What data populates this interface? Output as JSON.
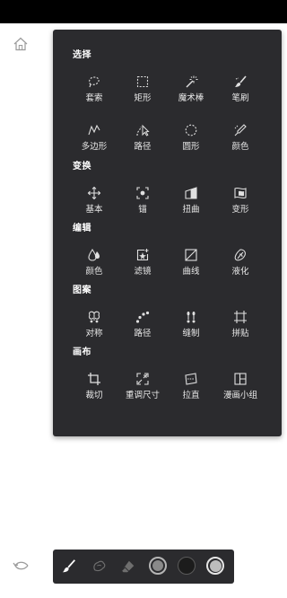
{
  "sections": [
    {
      "title": "选择",
      "tools": [
        {
          "label": "套索",
          "icon": "lasso-icon"
        },
        {
          "label": "矩形",
          "icon": "rectangle-select-icon"
        },
        {
          "label": "魔术棒",
          "icon": "magic-wand-icon"
        },
        {
          "label": "笔刷",
          "icon": "brush-select-icon"
        }
      ]
    },
    {
      "title": "",
      "tools": [
        {
          "label": "多边形",
          "icon": "polygon-lasso-icon"
        },
        {
          "label": "路径",
          "icon": "path-select-icon"
        },
        {
          "label": "圆形",
          "icon": "ellipse-select-icon"
        },
        {
          "label": "颜色",
          "icon": "color-picker-select-icon"
        }
      ]
    },
    {
      "title": "变换",
      "tools": [
        {
          "label": "基本",
          "icon": "move-icon"
        },
        {
          "label": "锚",
          "icon": "anchor-transform-icon"
        },
        {
          "label": "扭曲",
          "icon": "distort-icon"
        },
        {
          "label": "变形",
          "icon": "warp-icon"
        }
      ]
    },
    {
      "title": "编辑",
      "tools": [
        {
          "label": "颜色",
          "icon": "color-drops-icon"
        },
        {
          "label": "滤镜",
          "icon": "filter-icon"
        },
        {
          "label": "曲线",
          "icon": "curves-icon"
        },
        {
          "label": "液化",
          "icon": "liquify-icon"
        }
      ]
    },
    {
      "title": "图案",
      "tools": [
        {
          "label": "对称",
          "icon": "symmetry-icon"
        },
        {
          "label": "路径",
          "icon": "path-pattern-icon"
        },
        {
          "label": "缝制",
          "icon": "stitch-icon"
        },
        {
          "label": "拼贴",
          "icon": "tile-icon"
        }
      ]
    },
    {
      "title": "画布",
      "tools": [
        {
          "label": "裁切",
          "icon": "crop-icon"
        },
        {
          "label": "重调尺寸",
          "icon": "resize-icon"
        },
        {
          "label": "拉直",
          "icon": "straighten-icon"
        },
        {
          "label": "漫画小组",
          "icon": "comic-panels-icon"
        }
      ]
    }
  ],
  "toolbar": {
    "tools": [
      {
        "icon": "brush-icon",
        "active": true
      },
      {
        "icon": "smudge-icon",
        "active": false
      },
      {
        "icon": "eraser-icon",
        "active": false
      }
    ],
    "colors": [
      "#8a8a8a",
      "#1c1c1c",
      "#bdbdbd"
    ]
  }
}
